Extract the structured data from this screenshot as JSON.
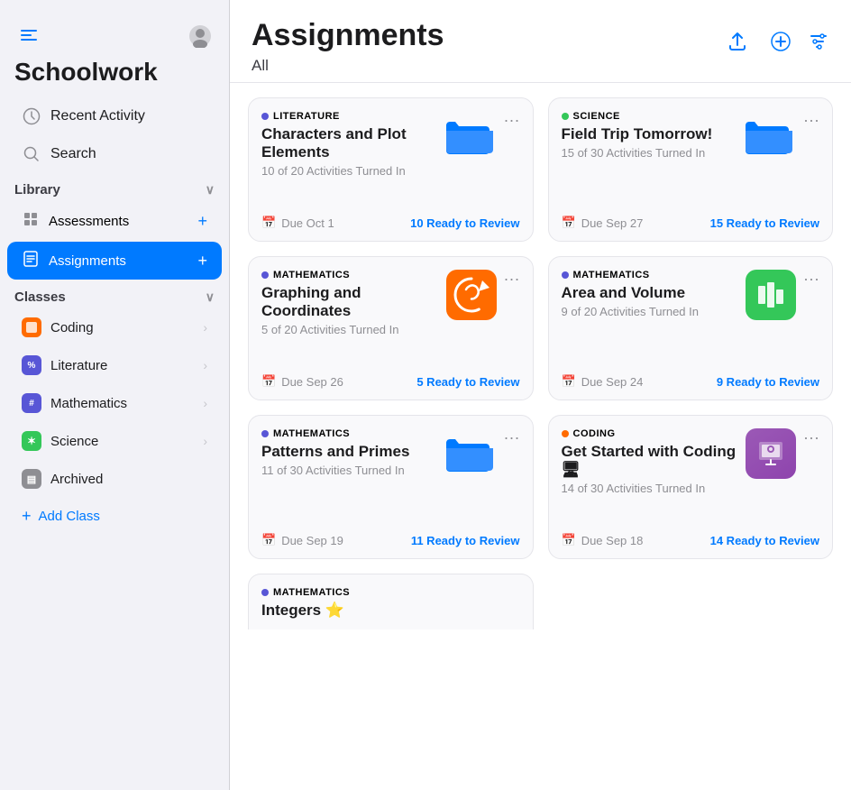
{
  "sidebar": {
    "toggle_icon": "⊞",
    "profile_icon": "👤",
    "title": "Schoolwork",
    "nav": {
      "recent_activity": "Recent Activity",
      "search": "Search"
    },
    "library": {
      "header": "Library",
      "assessments": "Assessments",
      "assignments": "Assignments"
    },
    "classes": {
      "header": "Classes",
      "items": [
        {
          "name": "Coding",
          "color": "coding",
          "symbol": "⬛"
        },
        {
          "name": "Literature",
          "color": "literature",
          "symbol": "%"
        },
        {
          "name": "Mathematics",
          "color": "mathematics",
          "symbol": "⊞"
        },
        {
          "name": "Science",
          "color": "science",
          "symbol": "✶"
        },
        {
          "name": "Archived",
          "color": "archived",
          "symbol": "⊟"
        }
      ],
      "add_class": "Add Class"
    }
  },
  "main": {
    "title": "Assignments",
    "filter_label": "All",
    "export_icon": "↑",
    "add_icon": "+",
    "filter_icon": "⊞",
    "cards": [
      {
        "id": "card-1",
        "subject": "LITERATURE",
        "subject_color": "#5856d6",
        "title": "Characters and Plot Elements",
        "subtitle": "10 of 20 Activities Turned In",
        "due": "Due Oct 1",
        "review": "10 Ready to Review",
        "icon_type": "folder",
        "icon_color": "blue"
      },
      {
        "id": "card-2",
        "subject": "SCIENCE",
        "subject_color": "#34c759",
        "title": "Field Trip Tomorrow!",
        "subtitle": "15 of 30 Activities Turned In",
        "due": "Due Sep 27",
        "review": "15 Ready to Review",
        "icon_type": "folder",
        "icon_color": "blue"
      },
      {
        "id": "card-3",
        "subject": "MATHEMATICS",
        "subject_color": "#5856d6",
        "title": "Graphing and Coordinates",
        "subtitle": "5 of 20 Activities Turned In",
        "due": "Due Sep 26",
        "review": "5 Ready to Review",
        "icon_type": "swift",
        "icon_color": "orange"
      },
      {
        "id": "card-4",
        "subject": "MATHEMATICS",
        "subject_color": "#5856d6",
        "title": "Area and Volume",
        "subtitle": "9 of 20 Activities Turned In",
        "due": "Due Sep 24",
        "review": "9 Ready to Review",
        "icon_type": "numbers",
        "icon_color": "green"
      },
      {
        "id": "card-5",
        "subject": "MATHEMATICS",
        "subject_color": "#5856d6",
        "title": "Patterns and Primes",
        "subtitle": "11 of 30 Activities Turned In",
        "due": "Due Sep 19",
        "review": "11 Ready to Review",
        "icon_type": "folder",
        "icon_color": "blue"
      },
      {
        "id": "card-6",
        "subject": "CODING",
        "subject_color": "#ff6b00",
        "title": "Get Started with Coding 🖥",
        "subtitle": "14 of 30 Activities Turned In",
        "due": "Due Sep 18",
        "review": "14 Ready to Review",
        "icon_type": "keynote",
        "icon_color": "purple"
      }
    ],
    "partial_card": {
      "subject": "MATHEMATICS",
      "subject_color": "#5856d6",
      "title": "Integers ⭐"
    }
  }
}
